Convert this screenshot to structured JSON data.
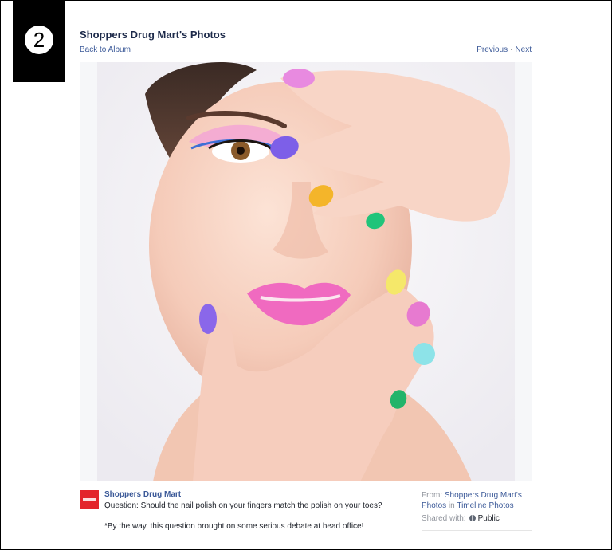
{
  "step": {
    "number": "2"
  },
  "header": {
    "album_title": "Shoppers Drug Mart's Photos",
    "back_label": "Back to Album",
    "previous_label": "Previous",
    "separator": "·",
    "next_label": "Next"
  },
  "photo": {
    "icon": "portrait-photo",
    "nail_colors": [
      "#e88ae0",
      "#7d5fe8",
      "#f4b52a",
      "#21c47a",
      "#f5e86a",
      "#e77ad0",
      "#8de3e8",
      "#23b46a",
      "#8a67ea"
    ]
  },
  "post": {
    "page_name": "Shoppers Drug Mart",
    "question": "Question: Should the nail polish on your fingers match the polish on your toes?",
    "note": "*By the way, this question brought on some serious debate at head office!",
    "logo_color": "#e3242b"
  },
  "meta": {
    "from_label": "From:",
    "from_page": "Shoppers Drug Mart's Photos",
    "in_label": "in",
    "album_name": "Timeline Photos",
    "shared_label": "Shared with:",
    "audience": "Public"
  },
  "colors": {
    "link": "#3b5998",
    "title": "#1d2a4a"
  }
}
